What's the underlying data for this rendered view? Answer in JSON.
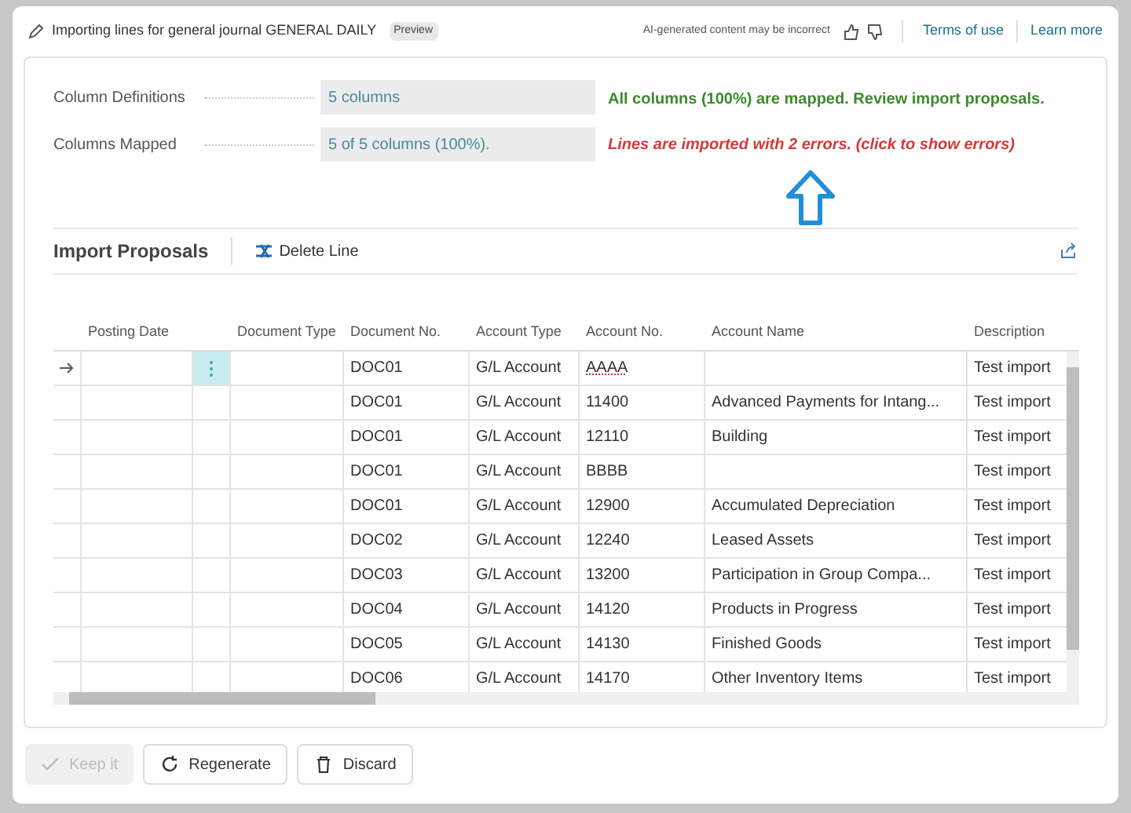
{
  "header": {
    "title": "Importing lines for general journal GENERAL DAILY",
    "badge": "Preview",
    "disclaimer": "AI-generated content may be incorrect",
    "links": [
      "Terms of use",
      "Learn more"
    ]
  },
  "fields": [
    {
      "label": "Column Definitions",
      "value": "5 columns"
    },
    {
      "label": "Columns Mapped",
      "value": "5 of 5 columns (100%)."
    }
  ],
  "messages": [
    {
      "kind": "success",
      "text": "All columns (100%) are mapped. Review import proposals."
    },
    {
      "kind": "error",
      "text": "Lines are imported with 2 errors. (click to show errors)"
    }
  ],
  "section": {
    "title": "Import Proposals",
    "actions": [
      "Delete Line"
    ]
  },
  "table": {
    "columns": [
      "Posting Date",
      "Document Type",
      "Document No.",
      "Account Type",
      "Account No.",
      "Account Name",
      "Description"
    ],
    "rows": [
      {
        "selected": true,
        "document_no": "DOC01",
        "account_type": "G/L Account",
        "account_no": "AAAA",
        "account_no_flagged": true,
        "account_name": "",
        "description": "Test import"
      },
      {
        "selected": false,
        "document_no": "DOC01",
        "account_type": "G/L Account",
        "account_no": "11400",
        "account_no_flagged": false,
        "account_name": "Advanced Payments for Intang...",
        "description": "Test import"
      },
      {
        "selected": false,
        "document_no": "DOC01",
        "account_type": "G/L Account",
        "account_no": "12110",
        "account_no_flagged": false,
        "account_name": "Building",
        "description": "Test import"
      },
      {
        "selected": false,
        "document_no": "DOC01",
        "account_type": "G/L Account",
        "account_no": "BBBB",
        "account_no_flagged": false,
        "account_name": "",
        "description": "Test import"
      },
      {
        "selected": false,
        "document_no": "DOC01",
        "account_type": "G/L Account",
        "account_no": "12900",
        "account_no_flagged": false,
        "account_name": "Accumulated Depreciation",
        "description": "Test import"
      },
      {
        "selected": false,
        "document_no": "DOC02",
        "account_type": "G/L Account",
        "account_no": "12240",
        "account_no_flagged": false,
        "account_name": "Leased Assets",
        "description": "Test import"
      },
      {
        "selected": false,
        "document_no": "DOC03",
        "account_type": "G/L Account",
        "account_no": "13200",
        "account_no_flagged": false,
        "account_name": "Participation in Group Compa...",
        "description": "Test import"
      },
      {
        "selected": false,
        "document_no": "DOC04",
        "account_type": "G/L Account",
        "account_no": "14120",
        "account_no_flagged": false,
        "account_name": "Products in Progress",
        "description": "Test import"
      },
      {
        "selected": false,
        "document_no": "DOC05",
        "account_type": "G/L Account",
        "account_no": "14130",
        "account_no_flagged": false,
        "account_name": "Finished Goods",
        "description": "Test import"
      },
      {
        "selected": false,
        "document_no": "DOC06",
        "account_type": "G/L Account",
        "account_no": "14170",
        "account_no_flagged": false,
        "account_name": "Other Inventory Items",
        "description": "Test import"
      }
    ]
  },
  "buttons": [
    {
      "kind": "keep",
      "label": "Keep it",
      "disabled": true
    },
    {
      "kind": "regenerate",
      "label": "Regenerate",
      "disabled": false
    },
    {
      "kind": "discard",
      "label": "Discard",
      "disabled": false
    }
  ]
}
